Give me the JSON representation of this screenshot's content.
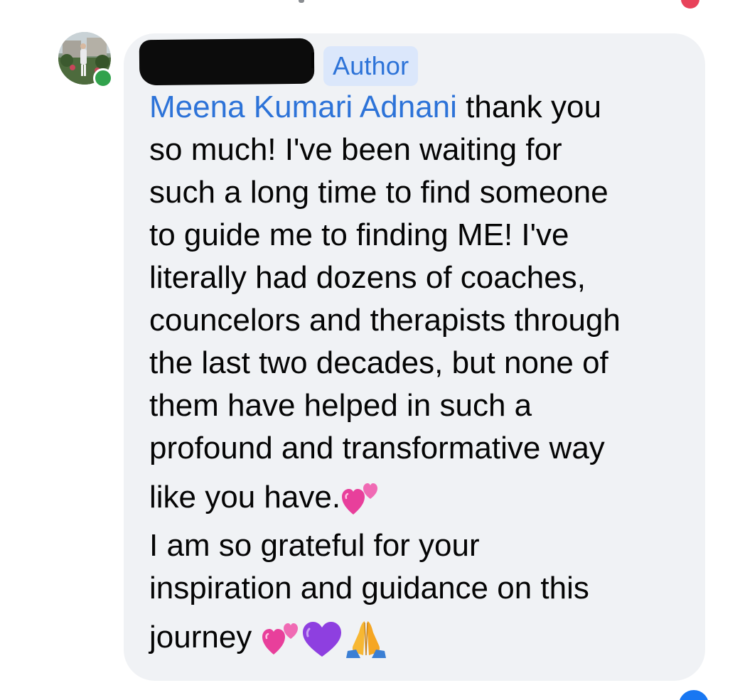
{
  "comment": {
    "author_badge": "Author",
    "mention": "Meena Kumari Adnani",
    "lines": [
      " thank you",
      "so much!  I've been waiting for",
      "such a long time to find someone",
      "to guide me to finding ME!  I've",
      "literally had dozens of coaches,",
      "councelors and therapists through",
      "the last two decades, but none of",
      "them have helped in such a",
      "profound and transformative way",
      "like you have.",
      "I am so grateful for your",
      "inspiration and guidance on this",
      "journey "
    ],
    "emojis": {
      "line10": [
        "two-hearts"
      ],
      "line13": [
        "two-hearts",
        "purple-heart",
        "folded-hands"
      ]
    }
  },
  "actions": {
    "time": "",
    "like": "",
    "reply": "",
    "reaction_count": ""
  },
  "colors": {
    "bubble": "#f0f2f5",
    "mention": "#2d73d8",
    "badge_bg": "#dbe7fb",
    "online": "#31a24c"
  },
  "icons": [
    "avatar",
    "online-status-icon",
    "two-hearts-emoji",
    "purple-heart-emoji",
    "folded-hands-emoji",
    "like-reaction-icon"
  ]
}
